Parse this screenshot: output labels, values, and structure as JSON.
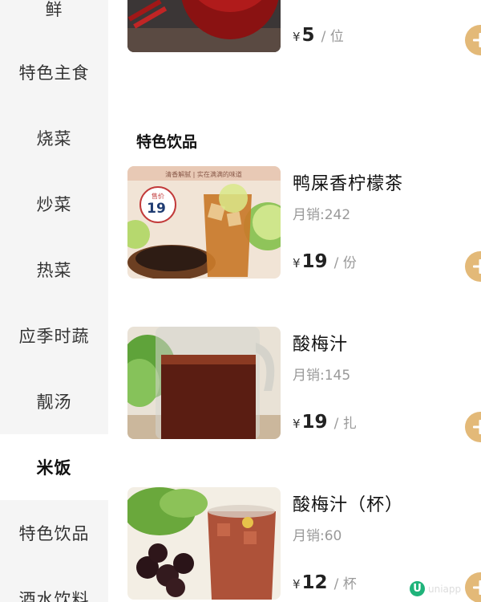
{
  "sidebar": {
    "items": [
      {
        "label": "鲜"
      },
      {
        "label": "特色主食"
      },
      {
        "label": "烧菜"
      },
      {
        "label": "炒菜"
      },
      {
        "label": "热菜"
      },
      {
        "label": "应季时蔬"
      },
      {
        "label": "靓汤"
      },
      {
        "label": "米饭",
        "active": true
      },
      {
        "label": "特色饮品"
      },
      {
        "label": "酒水饮料"
      }
    ]
  },
  "main": {
    "top_item": {
      "currency": "¥",
      "price": "5",
      "unit": "/ 位"
    },
    "section_title": "特色饮品",
    "products": [
      {
        "name": "鸭屎香柠檬茶",
        "sales": "月销:242",
        "currency": "¥",
        "price": "19",
        "unit": "/ 份",
        "image_badge_label": "售价",
        "image_badge_price": "19",
        "image_banner": "清香解腻 | 实在满满的味道"
      },
      {
        "name": "酸梅汁",
        "sales": "月销:145",
        "currency": "¥",
        "price": "19",
        "unit": "/ 扎"
      },
      {
        "name": "酸梅汁（杯）",
        "sales": "月销:60",
        "currency": "¥",
        "price": "12",
        "unit": "/ 杯"
      }
    ]
  },
  "watermark": {
    "logo": "U",
    "text": "uniapp"
  },
  "colors": {
    "accent": "#e3b978",
    "sidebar_bg": "#f5f5f5"
  }
}
